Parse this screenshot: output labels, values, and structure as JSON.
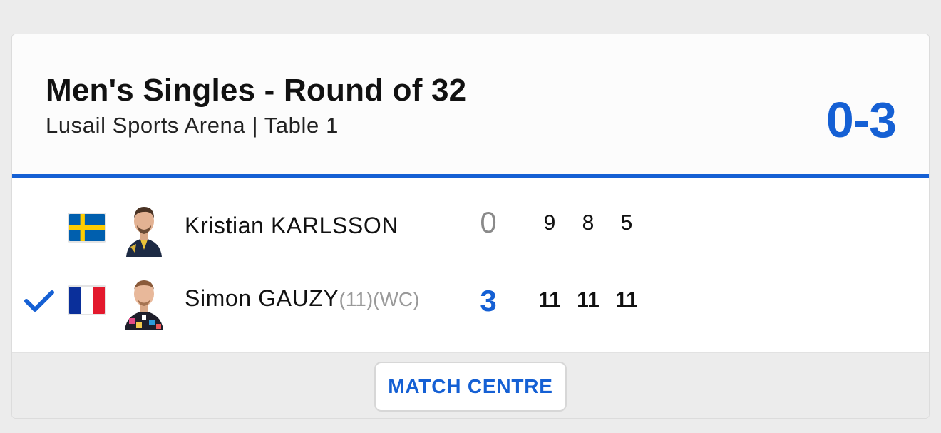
{
  "match": {
    "title": "Men's Singles - Round of 32",
    "venue": "Lusail Sports Arena | Table 1",
    "final_score": "0-3",
    "accent_color": "#1560d4"
  },
  "players": [
    {
      "name": "Kristian KARLSSON",
      "seed": "",
      "tag": "",
      "country_flag": "sweden-flag",
      "sets_won": "0",
      "games": [
        "9",
        "8",
        "5"
      ],
      "winner": false
    },
    {
      "name": "Simon GAUZY",
      "seed": "(11)",
      "tag": "(WC)",
      "country_flag": "france-flag",
      "sets_won": "3",
      "games": [
        "11",
        "11",
        "11"
      ],
      "winner": true
    }
  ],
  "footer": {
    "match_centre_label": "MATCH CENTRE"
  }
}
